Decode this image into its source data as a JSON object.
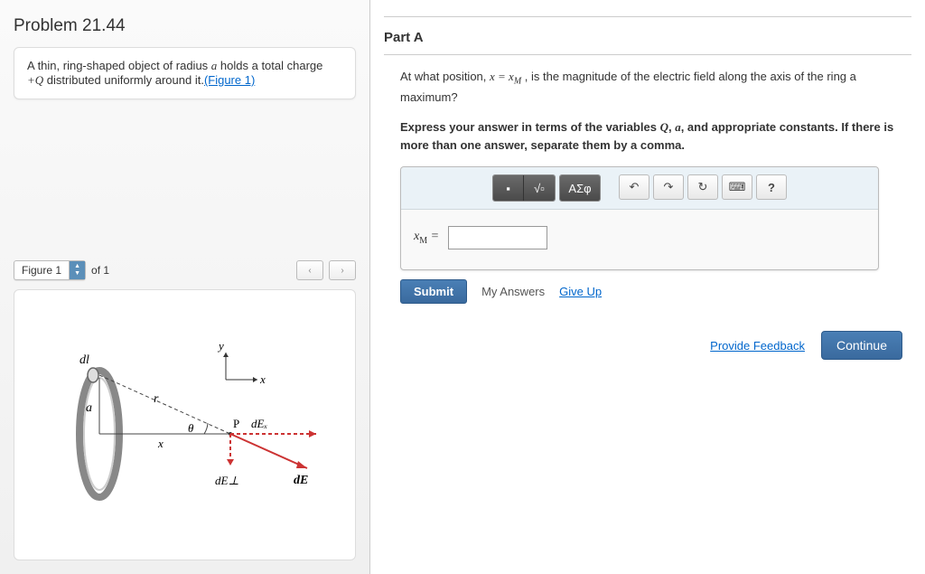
{
  "problem": {
    "title": "Problem 21.44",
    "description_prefix": "A thin, ring-shaped object of radius ",
    "var_a": "a",
    "description_mid": " holds a total charge ",
    "var_Q": "+Q",
    "description_suffix": " distributed uniformly around it.",
    "figure_link_label": "(Figure 1)"
  },
  "figure": {
    "selector_label": "Figure 1",
    "count_label": "of 1",
    "prev": "‹",
    "next": "›",
    "labels": {
      "dl": "dl",
      "a": "a",
      "r": "r",
      "x_axis": "x",
      "y_axis": "y",
      "theta": "θ",
      "x_lower": "x",
      "P": "P",
      "dEx": "dEₓ",
      "dEperp": "dE⊥",
      "dE": "dE"
    }
  },
  "part": {
    "header": "Part A",
    "question_prefix": "At what position, ",
    "eqn": "x = x",
    "sub_M": "M",
    "question_suffix": " , is the magnitude of the electric field along the axis of the ring a maximum?",
    "instruction_prefix": "Express your answer in terms of the variables ",
    "var_Q": "Q",
    "instruction_mid": ", ",
    "var_a": "a",
    "instruction_suffix": ", and appropriate constants. If there is more than one answer, separate them by a comma."
  },
  "toolbar": {
    "template": "▪",
    "sqrt": "√▫",
    "greek": "ΑΣφ",
    "undo": "↶",
    "redo": "↷",
    "reset": "↻",
    "keyboard": "⌨",
    "help": "?"
  },
  "answer": {
    "label_var": "x",
    "label_sub": "M",
    "label_eq": " =",
    "value": ""
  },
  "actions": {
    "submit": "Submit",
    "my_answers": "My Answers",
    "give_up": "Give Up",
    "provide_feedback": "Provide Feedback",
    "continue": "Continue"
  }
}
